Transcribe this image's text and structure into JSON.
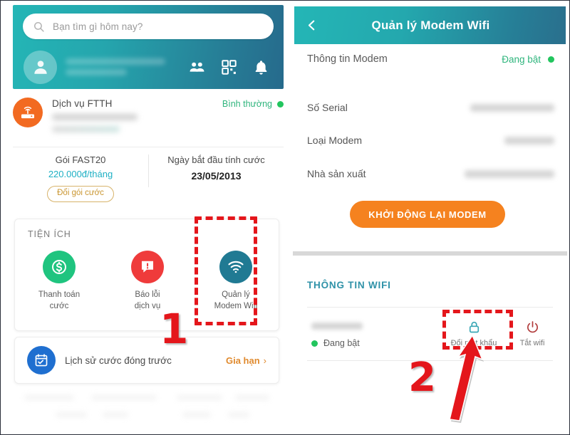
{
  "left_screen": {
    "search": {
      "placeholder": "Bạn tìm gì hôm nay?",
      "icon": "search-icon"
    },
    "header_icons": [
      "friends-icon",
      "qr-code-icon",
      "bell-icon"
    ],
    "service": {
      "icon": "modem-router-icon",
      "title": "Dịch vụ FTTH",
      "status": "Bình thường",
      "status_color": "#22c55e"
    },
    "plan": {
      "name": "Gói FAST20",
      "price": "220.000đ/tháng",
      "change_button": "Đổi gói cước",
      "billing_label": "Ngày bắt đầu tính cước",
      "billing_date": "23/05/2013"
    },
    "utilities": {
      "title": "TIỆN ÍCH",
      "items": [
        {
          "label": "Thanh toán cước",
          "line1": "Thanh toán",
          "line2": "cước",
          "icon": "dollar-circle-icon",
          "color": "#1fc47f"
        },
        {
          "label": "Báo lỗi dịch vụ",
          "line1": "Báo lỗi",
          "line2": "dịch vụ",
          "icon": "alert-message-icon",
          "color": "#ef3b3b"
        },
        {
          "label": "Quản lý Modem Wifi",
          "line1": "Quản lý",
          "line2": "Modem Wifi",
          "icon": "wifi-icon",
          "color": "#207a93"
        }
      ]
    },
    "history": {
      "label": "Lịch sử cước đóng trước",
      "action": "Gia hạn",
      "chevron": "›",
      "icon": "calendar-check-icon"
    }
  },
  "right_screen": {
    "header": {
      "back_icon": "chevron-left-icon",
      "title": "Quản lý Modem Wifi"
    },
    "modem_section": {
      "title": "Thông tin Modem",
      "status": "Đang bật",
      "rows": [
        {
          "key": "Số Serial",
          "value": ""
        },
        {
          "key": "Loại Modem",
          "value": ""
        },
        {
          "key": "Nhà sản xuất",
          "value": ""
        }
      ],
      "restart_button": "KHỞI ĐỘNG LẠI MODEM"
    },
    "wifi_section": {
      "title": "THÔNG TIN WIFI",
      "status": "Đang bật",
      "actions": [
        {
          "label": "Đổi mật khẩu",
          "icon": "lock-icon",
          "color": "#3aa7b5"
        },
        {
          "label": "Tắt wifi",
          "icon": "power-icon",
          "color": "#b03a3a"
        }
      ]
    }
  },
  "annotations": {
    "step_1": "1",
    "step_2": "2",
    "highlight_color": "#e4161b"
  }
}
